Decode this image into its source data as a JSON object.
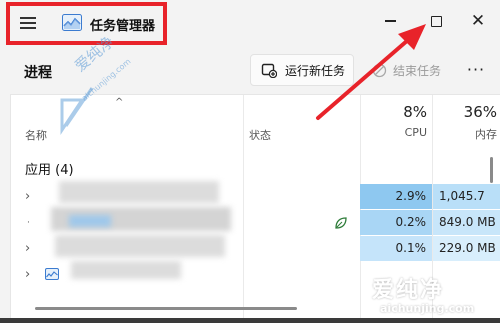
{
  "window": {
    "title": "任务管理器",
    "min_glyph": "—",
    "close_glyph": "✕"
  },
  "toolbar": {
    "heading": "进程",
    "run_new_task": "运行新任务",
    "end_task": "结束任务",
    "more": "···"
  },
  "table": {
    "sort_glyph": "^",
    "columns": {
      "name": "名称",
      "status": "状态",
      "cpu_percent": "8%",
      "cpu": "CPU",
      "mem_percent": "36%",
      "mem": "内存"
    },
    "group_label": "应用 (4)",
    "rows": [
      {
        "cpu": "2.9%",
        "mem": "1,045.7"
      },
      {
        "cpu": "0.2%",
        "mem": "849.0 MB"
      },
      {
        "cpu": "0.1%",
        "mem": "229.0 MB"
      },
      {
        "cpu": "",
        "mem": ""
      }
    ]
  },
  "watermark": {
    "primary": "爱纯净",
    "primary_url": "aichunjing.com",
    "secondary": "爱纯净",
    "secondary_url": "aichunjing.com"
  },
  "colors": {
    "highlight": "#e8232a",
    "cpu_row_1": "#8ec8f0",
    "cpu_row_2": "#a9d6f5",
    "cpu_row_3": "#c5e4fa",
    "mem_row_1": "#b9dff8",
    "mem_row_2": "#c8e6fa",
    "mem_row_3": "#d8eefc"
  }
}
